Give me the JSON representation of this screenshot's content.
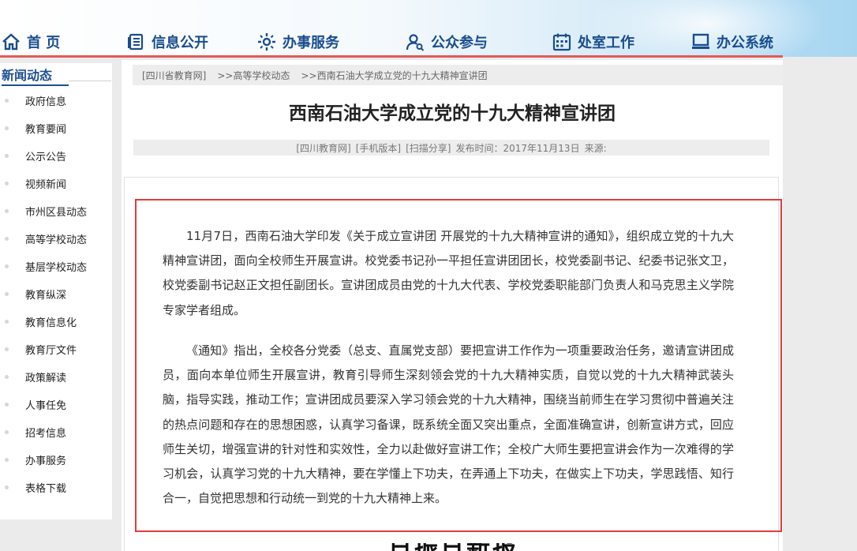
{
  "nav": {
    "items": [
      {
        "label": "首 页",
        "icon": "home-icon"
      },
      {
        "label": "信息公开",
        "icon": "document-list-icon"
      },
      {
        "label": "办事服务",
        "icon": "service-gear-icon"
      },
      {
        "label": "公众参与",
        "icon": "user-search-icon"
      },
      {
        "label": "处室工作",
        "icon": "calendar-icon"
      },
      {
        "label": "办公系统",
        "icon": "monitor-icon"
      }
    ],
    "accent_color": "#e35a5a",
    "text_color": "#1a4d8c"
  },
  "sidebar": {
    "title": "新闻动态",
    "items": [
      {
        "label": "政府信息"
      },
      {
        "label": "教育要闻"
      },
      {
        "label": "公示公告"
      },
      {
        "label": "视频新闻"
      },
      {
        "label": "市州区县动态"
      },
      {
        "label": "高等学校动态"
      },
      {
        "label": "基层学校动态"
      },
      {
        "label": "教育纵深"
      },
      {
        "label": "教育信息化"
      },
      {
        "label": "教育厅文件"
      },
      {
        "label": "政策解读"
      },
      {
        "label": "人事任免"
      },
      {
        "label": "招考信息"
      },
      {
        "label": "办事服务"
      },
      {
        "label": "表格下载"
      }
    ]
  },
  "breadcrumb": {
    "items": [
      "[四川省教育网]",
      ">>高等学校动态",
      ">>西南石油大学成立党的十九大精神宣讲团"
    ]
  },
  "article": {
    "title": "西南石油大学成立党的十九大精神宣讲团",
    "meta": {
      "source_link": "[四川教育网]",
      "mobile_link": "[手机版本]",
      "share_link": "[扫描分享]",
      "publish_label": "发布时间：2017年11月13日",
      "origin_label": "来源:"
    },
    "paragraphs": [
      "11月7日，西南石油大学印发《关于成立宣讲团 开展党的十九大精神宣讲的通知》，组织成立党的十九大精神宣讲团，面向全校师生开展宣讲。校党委书记孙一平担任宣讲团团长，校党委副书记、纪委书记张文卫，校党委副书记赵正文担任副团长。宣讲团成员由党的十九大代表、学校党委职能部门负责人和马克思主义学院专家学者组成。",
      "《通知》指出，全校各分党委（总支、直属党支部）要把宣讲工作作为一项重要政治任务，邀请宣讲团成员，面向本单位师生开展宣讲，教育引导师生深刻领会党的十九大精神实质，自觉以党的十九大精神武装头脑，指导实践，推动工作；宣讲团成员要深入学习领会党的十九大精神，围绕当前师生在学习贯彻中普遍关注的热点问题和存在的思想困惑，认真学习备课，既系统全面又突出重点，全面准确宣讲，创新宣讲方式，回应师生关切，增强宣讲的针对性和实效性，全力以赴做好宣讲工作；全校广大师生要把宣讲会作为一次难得的学习机会，认真学习党的十九大精神，要在学懂上下功夫，在弄通上下功夫，在做实上下功夫，学思践悟、知行合一，自觉把思想和行动统一到党的十九大精神上来。"
    ],
    "next_heading_fragment": "日振日新报",
    "highlight_color": "#e23c3c"
  }
}
